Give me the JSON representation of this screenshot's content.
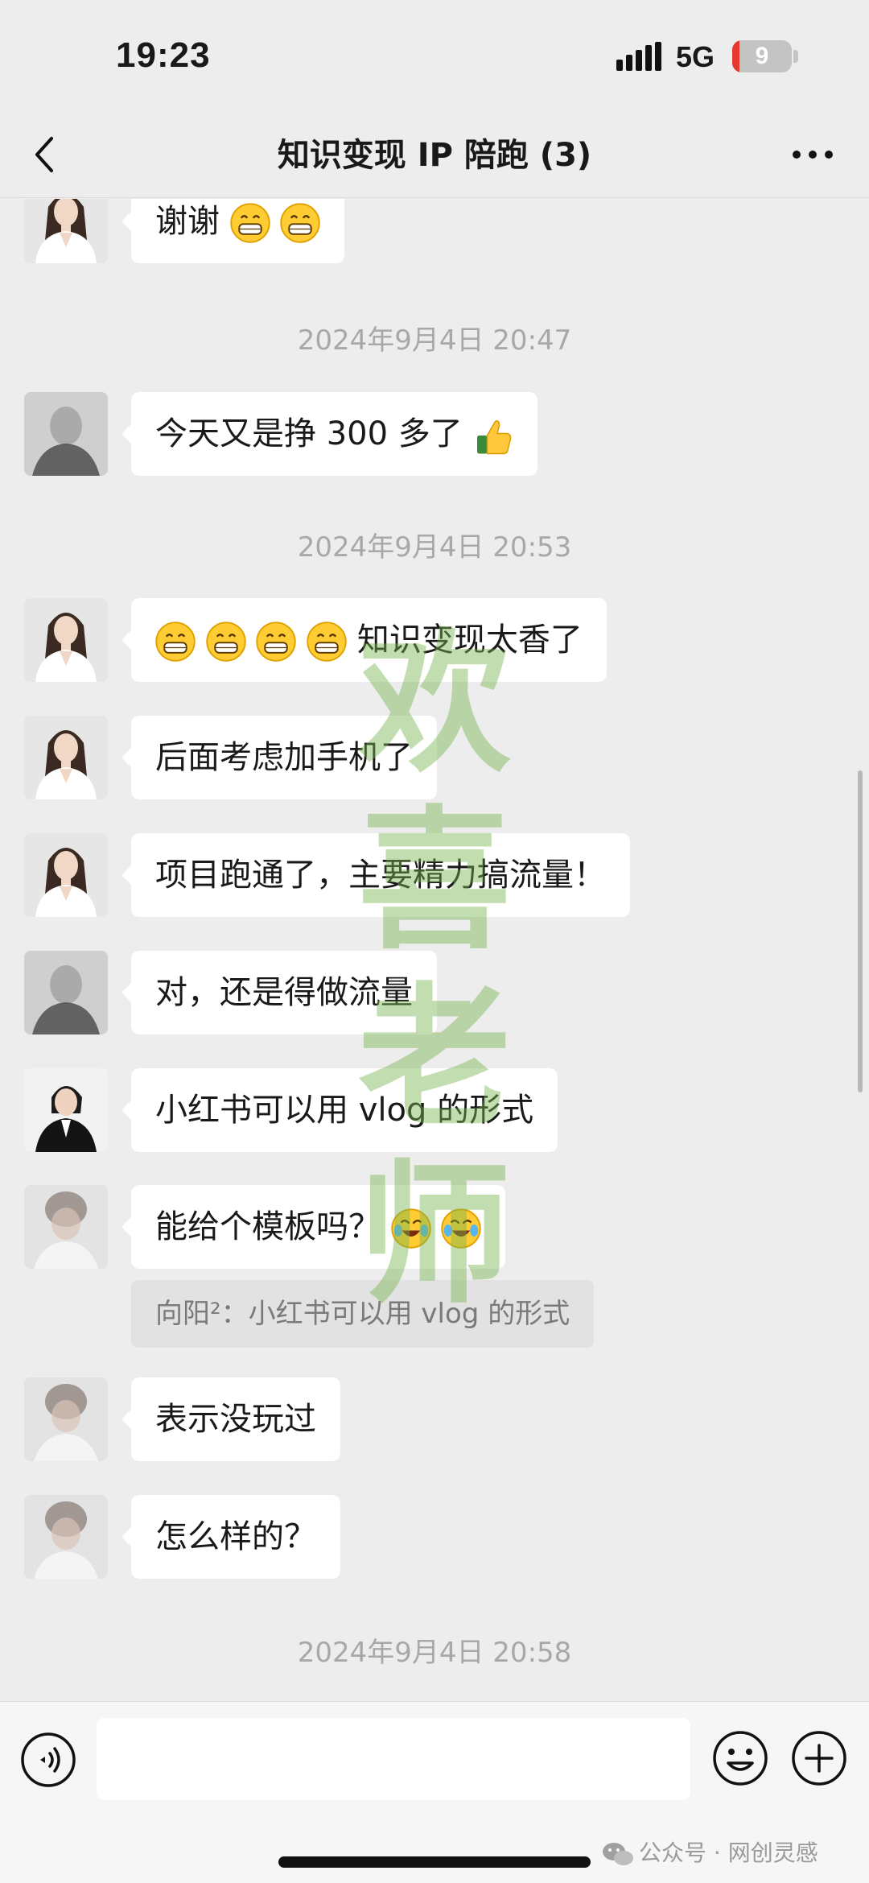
{
  "status_bar": {
    "time": "19:23",
    "network": "5G",
    "battery": "9",
    "battery_level_pct": 12
  },
  "nav": {
    "title": "知识变现 IP 陪跑 (3)"
  },
  "timestamps": [
    "2024年9月4日 20:47",
    "2024年9月4日 20:53",
    "2024年9月4日 20:58"
  ],
  "messages": [
    {
      "text": "谢谢",
      "emoji": [
        "grin",
        "grin"
      ]
    },
    {
      "text": "今天又是挣 300 多了",
      "emoji_after": [
        "thumbs-up"
      ]
    },
    {
      "text": "知识变现太香了",
      "emoji_before": [
        "grin",
        "grin",
        "grin",
        "grin"
      ]
    },
    {
      "text": "后面考虑加手机了"
    },
    {
      "text": "项目跑通了，主要精力搞流量！"
    },
    {
      "text": "对，还是得做流量"
    },
    {
      "text": "小红书可以用 vlog 的形式"
    },
    {
      "text": "能给个模板吗？",
      "emoji": [
        "rofl",
        "rofl"
      ]
    },
    {
      "text": "表示没玩过"
    },
    {
      "text": "怎么样的？"
    }
  ],
  "quote": {
    "text": "向阳²：小红书可以用 vlog 的形式"
  },
  "watermark": [
    "欢",
    "喜",
    "老",
    "师"
  ],
  "input_bar": {
    "placeholder": ""
  },
  "credit": {
    "text": "公众号 · 网创灵感"
  },
  "colors": {
    "background": "#ededed",
    "bubble": "#ffffff",
    "watermark": "#78b450"
  }
}
